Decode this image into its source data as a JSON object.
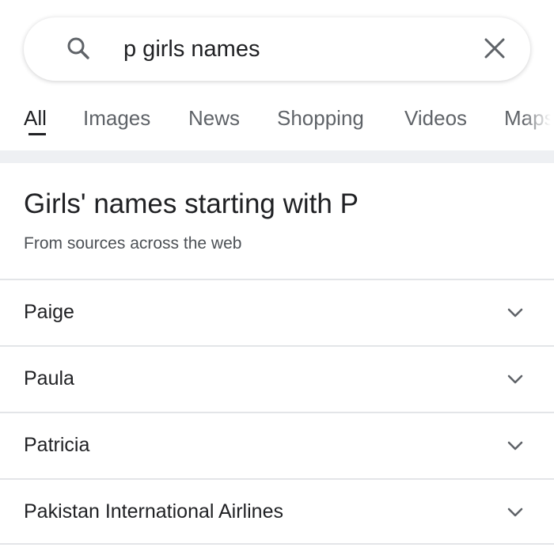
{
  "search": {
    "query": "p girls names",
    "search_icon": "search-icon",
    "clear_icon": "close-icon"
  },
  "tabs": [
    {
      "label": "All",
      "active": true
    },
    {
      "label": "Images",
      "active": false
    },
    {
      "label": "News",
      "active": false
    },
    {
      "label": "Shopping",
      "active": false
    },
    {
      "label": "Videos",
      "active": false
    },
    {
      "label": "Maps",
      "active": false
    }
  ],
  "section": {
    "title": "Girls' names starting with P",
    "subtitle": "From sources across the web",
    "items": [
      {
        "label": "Paige",
        "icon": "chevron-down-icon"
      },
      {
        "label": "Paula",
        "icon": "chevron-down-icon"
      },
      {
        "label": "Patricia",
        "icon": "chevron-down-icon"
      },
      {
        "label": "Pakistan International Airlines",
        "icon": "chevron-down-icon"
      }
    ]
  },
  "colors": {
    "text_primary": "#202124",
    "text_secondary": "#5f6368",
    "divider": "#e3e5e8",
    "separator_band": "#eef0f3"
  }
}
